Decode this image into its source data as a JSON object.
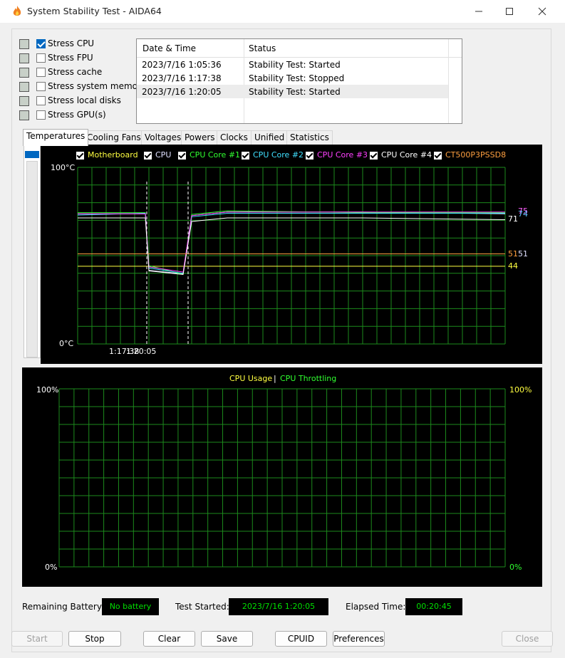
{
  "window": {
    "title": "System Stability Test - AIDA64"
  },
  "stress": [
    {
      "label": "Stress CPU",
      "checked": true,
      "icon": "cpu-chip-icon"
    },
    {
      "label": "Stress FPU",
      "checked": false,
      "icon": "fpu-percent-icon"
    },
    {
      "label": "Stress cache",
      "checked": false,
      "icon": "cache-chip-icon"
    },
    {
      "label": "Stress system memory",
      "checked": false,
      "icon": "memory-module-icon"
    },
    {
      "label": "Stress local disks",
      "checked": false,
      "icon": "disk-drive-icon"
    },
    {
      "label": "Stress GPU(s)",
      "checked": false,
      "icon": "monitor-icon"
    }
  ],
  "log": {
    "columns": [
      "Date & Time",
      "Status"
    ],
    "rows": [
      {
        "time": "2023/7/16 1:05:36",
        "status": "Stability Test: Started"
      },
      {
        "time": "2023/7/16 1:17:38",
        "status": "Stability Test: Stopped"
      },
      {
        "time": "2023/7/16 1:20:05",
        "status": "Stability Test: Started"
      }
    ]
  },
  "tabs": [
    "Temperatures",
    "Cooling Fans",
    "Voltages",
    "Powers",
    "Clocks",
    "Unified",
    "Statistics"
  ],
  "temp_graph": {
    "legend": [
      {
        "label": "Motherboard",
        "color": "#ffff40"
      },
      {
        "label": "CPU",
        "color": "#e0e0ff"
      },
      {
        "label": "CPU Core #1",
        "color": "#30ff30"
      },
      {
        "label": "CPU Core #2",
        "color": "#40e0ff"
      },
      {
        "label": "CPU Core #3",
        "color": "#ff40ff"
      },
      {
        "label": "CPU Core #4",
        "color": "#ffffff"
      },
      {
        "label": "CT500P3PSSD8",
        "color": "#ffa040"
      }
    ],
    "y_top": "100°C",
    "y_bottom": "0°C",
    "x_label_a": "1:17:38",
    "x_label_b": "1:20:05",
    "right_values": {
      "v75": "75",
      "v74": "74",
      "v71": "71",
      "v51a": "51",
      "v51b": "51",
      "v44": "44"
    }
  },
  "cpu_graph": {
    "title_usage": "CPU Usage",
    "title_sep": "|",
    "title_throttle": "CPU Throttling",
    "left_top": "100%",
    "left_bottom": "0%",
    "right_top": "100%",
    "right_bottom": "0%"
  },
  "status": {
    "battery_label": "Remaining Battery:",
    "battery_value": "No battery",
    "started_label": "Test Started:",
    "started_value": "2023/7/16 1:20:05",
    "elapsed_label": "Elapsed Time:",
    "elapsed_value": "00:20:45"
  },
  "buttons": {
    "start": "Start",
    "stop": "Stop",
    "clear": "Clear",
    "save": "Save",
    "cpuid": "CPUID",
    "preferences": "Preferences",
    "close": "Close"
  },
  "chart_data": {
    "type": "line",
    "ylim": [
      0,
      100
    ],
    "series": [
      {
        "name": "Motherboard",
        "values": [
          44,
          44,
          44,
          44,
          44,
          44,
          44,
          44
        ]
      },
      {
        "name": "CPU",
        "values": [
          74,
          74,
          42,
          40,
          73,
          75,
          75,
          74
        ]
      },
      {
        "name": "CPU Core #1",
        "values": [
          75,
          75,
          45,
          40,
          74,
          76,
          75,
          75
        ]
      },
      {
        "name": "CPU Core #2",
        "values": [
          73,
          74,
          43,
          40,
          72,
          74,
          74,
          74
        ]
      },
      {
        "name": "CPU Core #3",
        "values": [
          74,
          74,
          44,
          41,
          73,
          75,
          75,
          75
        ]
      },
      {
        "name": "CPU Core #4",
        "values": [
          72,
          72,
          42,
          40,
          70,
          72,
          72,
          71
        ]
      },
      {
        "name": "CT500P3PSSD8",
        "values": [
          51,
          51,
          51,
          51,
          51,
          51,
          51,
          51
        ]
      }
    ]
  }
}
